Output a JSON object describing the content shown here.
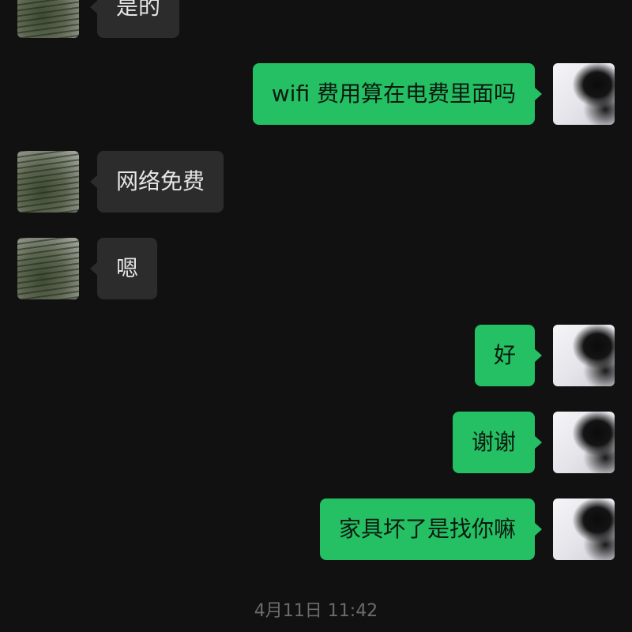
{
  "messages": [
    {
      "side": "in",
      "text": "是的"
    },
    {
      "side": "out",
      "text": "wifi 费用算在电费里面吗"
    },
    {
      "side": "in",
      "text": "网络免费"
    },
    {
      "side": "in",
      "text": "嗯"
    },
    {
      "side": "out",
      "text": "好"
    },
    {
      "side": "out",
      "text": "谢谢"
    },
    {
      "side": "out",
      "text": "家具坏了是找你嘛"
    }
  ],
  "timestamp": "4月11日 11:42",
  "colors": {
    "background": "#111111",
    "incoming_bubble": "#2c2c2c",
    "outgoing_bubble": "#24c063",
    "timestamp_text": "#6b6b6b"
  }
}
